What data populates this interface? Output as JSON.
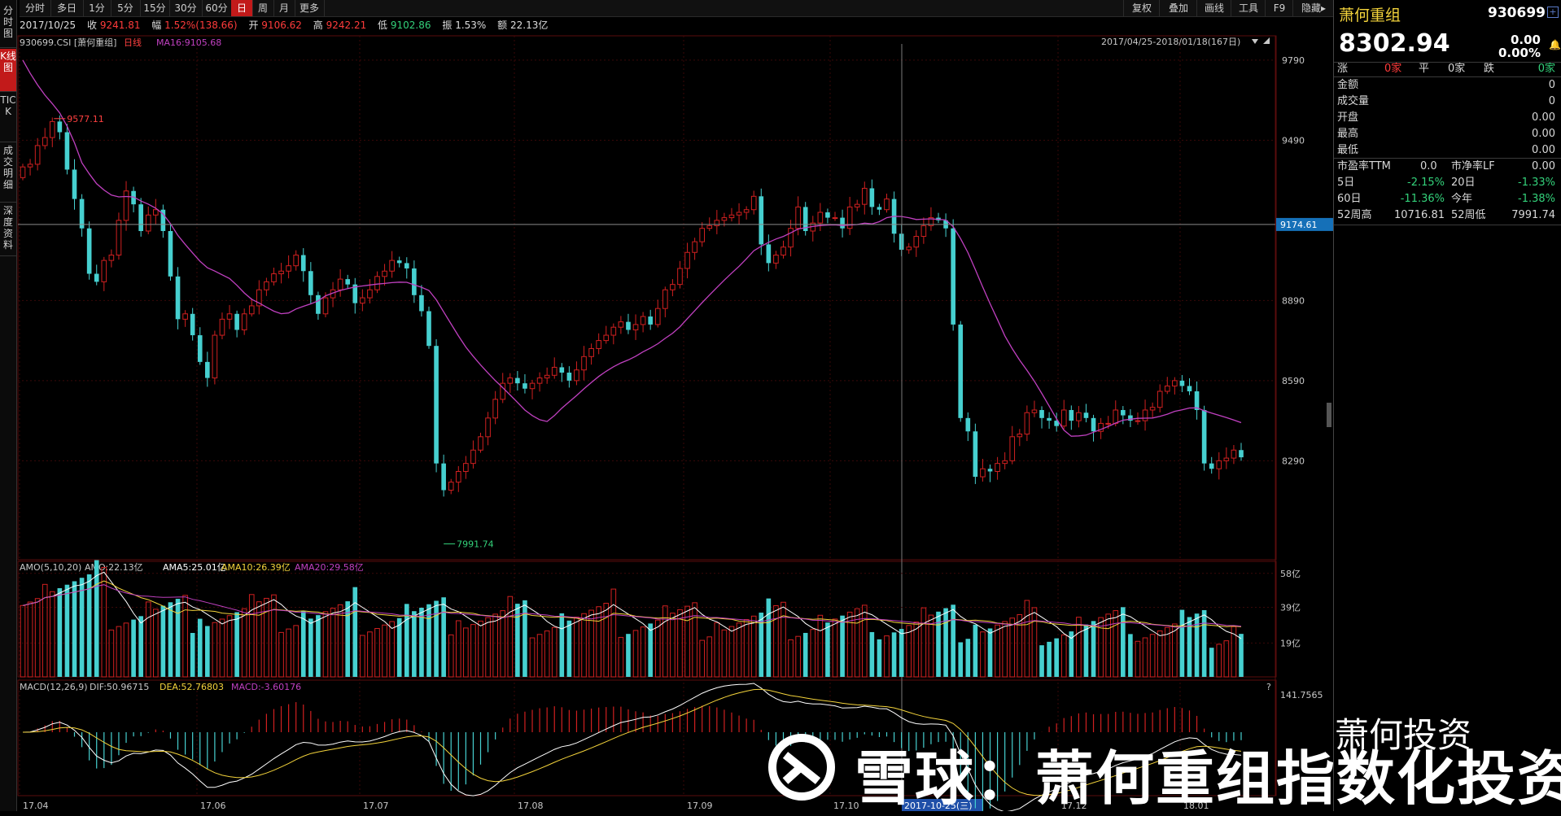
{
  "top_tabs": [
    "分时",
    "多日",
    "1分",
    "5分",
    "15分",
    "30分",
    "60分",
    "日",
    "周",
    "月",
    "更多"
  ],
  "active_tab": "日",
  "toolbar": [
    "复权",
    "叠加",
    "画线",
    "工具",
    "F9",
    "隐藏▸"
  ],
  "left_tabs": [
    "分时图",
    "K线图",
    "TICK",
    "成交明细",
    "深度资料"
  ],
  "active_left_tab": "K线图",
  "info": {
    "date": "2017/10/25",
    "close_label": "收",
    "close": "9241.81",
    "change_label": "幅",
    "change": "1.52%(138.66)",
    "open_label": "开",
    "open": "9106.62",
    "high_label": "高",
    "high": "9242.21",
    "low_label": "低",
    "low": "9102.86",
    "amp_label": "振",
    "amp": "1.53%",
    "amount_label": "额",
    "amount": "22.13亿"
  },
  "kline": {
    "code_label": "930699.CSI [萧何重组]",
    "period_label": "日线",
    "ma_label": "MA16:9105.68",
    "range_label": "2017/04/25-2018/01/18(167日)",
    "price_ticks": [
      "9790",
      "9490",
      "8890",
      "8590",
      "8290"
    ],
    "current_price_tag": "9174.61",
    "high_marker": "9577.11",
    "low_marker": "7991.74"
  },
  "amo": {
    "label": "AMO(5,10,20)",
    "amo": "AMO:22.13亿",
    "ama5": "AMA5:25.01亿",
    "ama10": "AMA10:26.39亿",
    "ama20": "AMA20:29.58亿",
    "ticks": [
      "58亿",
      "39亿",
      "19亿"
    ]
  },
  "macd": {
    "label": "MACD(12,26,9)",
    "dif": "DIF:50.96715",
    "dea": "DEA:52.76803",
    "macd": "MACD:-3.60176",
    "top_tick": "141.7565",
    "question": "?"
  },
  "x_axis": [
    "17.04",
    "17.06",
    "17.07",
    "17.08",
    "17.09",
    "17.10",
    "17.12",
    "18.01"
  ],
  "cursor_date": "2017-10-25(三)",
  "right_panel": {
    "name": "萧何重组",
    "code": "930699",
    "price": "8302.94",
    "chg": "0.00",
    "chg_pct": "0.00%",
    "rise_label": "涨",
    "rise_val": "0家",
    "flat_label": "平",
    "flat_val": "0家",
    "fall_label": "跌",
    "fall_val": "0家",
    "stats": [
      {
        "k": "金额",
        "v": "0"
      },
      {
        "k": "成交量",
        "v": "0"
      },
      {
        "k": "开盘",
        "v": "0.00"
      },
      {
        "k": "最高",
        "v": "0.00"
      },
      {
        "k": "最低",
        "v": "0.00"
      }
    ],
    "pe_label": "市盈率TTM",
    "pe_val": "0.0",
    "pb_label": "市净率LF",
    "pb_val": "0.00",
    "perf": [
      {
        "k1": "5日",
        "v1": "-2.15%",
        "k2": "20日",
        "v2": "-1.33%"
      },
      {
        "k1": "60日",
        "v1": "-11.36%",
        "k2": "今年",
        "v2": "-1.38%"
      },
      {
        "k1": "52周高",
        "v1": "10716.81",
        "k2": "52周低",
        "v2": "7991.74"
      }
    ]
  },
  "watermark": {
    "main": "雪球：萧何重组指数化投资",
    "small": "萧何投资"
  },
  "colors": {
    "up": "#d02020",
    "down": "#46d0d0",
    "ma": "#c040c0",
    "bg": "#000000"
  },
  "chart_data": {
    "type": "candlestick",
    "closes": [
      9390,
      9400,
      9470,
      9500,
      9560,
      9520,
      9380,
      9270,
      9160,
      8990,
      8960,
      9040,
      9060,
      9190,
      9300,
      9250,
      9150,
      9210,
      9230,
      9150,
      8980,
      8820,
      8840,
      8760,
      8660,
      8600,
      8760,
      8820,
      8840,
      8780,
      8840,
      8870,
      8930,
      8960,
      8990,
      9000,
      9020,
      9060,
      9000,
      8910,
      8840,
      8900,
      8930,
      8970,
      8950,
      8880,
      8900,
      8930,
      8980,
      9000,
      9040,
      9030,
      9010,
      8910,
      8850,
      8720,
      8280,
      8180,
      8210,
      8250,
      8280,
      8330,
      8380,
      8450,
      8520,
      8580,
      8600,
      8580,
      8560,
      8580,
      8600,
      8610,
      8640,
      8620,
      8590,
      8630,
      8680,
      8710,
      8740,
      8760,
      8790,
      8810,
      8780,
      8800,
      8830,
      8800,
      8860,
      8930,
      8950,
      9010,
      9070,
      9110,
      9160,
      9170,
      9190,
      9200,
      9210,
      9220,
      9230,
      9280,
      9100,
      9030,
      9060,
      9090,
      9160,
      9240,
      9150,
      9180,
      9220,
      9200,
      9200,
      9160,
      9240,
      9250,
      9310,
      9240,
      9230,
      9270,
      9140,
      9080,
      9090,
      9130,
      9170,
      9200,
      9190,
      9160,
      8800,
      8450,
      8400,
      8230,
      8260,
      8250,
      8280,
      8290,
      8380,
      8390,
      8470,
      8480,
      8450,
      8440,
      8420,
      8480,
      8440,
      8470,
      8450,
      8400,
      8430,
      8430,
      8480,
      8460,
      8440,
      8440,
      8480,
      8490,
      8550,
      8570,
      8590,
      8570,
      8550,
      8480,
      8280,
      8260,
      8290,
      8300,
      8330,
      8303
    ],
    "ma16_start": 9790,
    "price_range": [
      7950,
      9820
    ]
  }
}
